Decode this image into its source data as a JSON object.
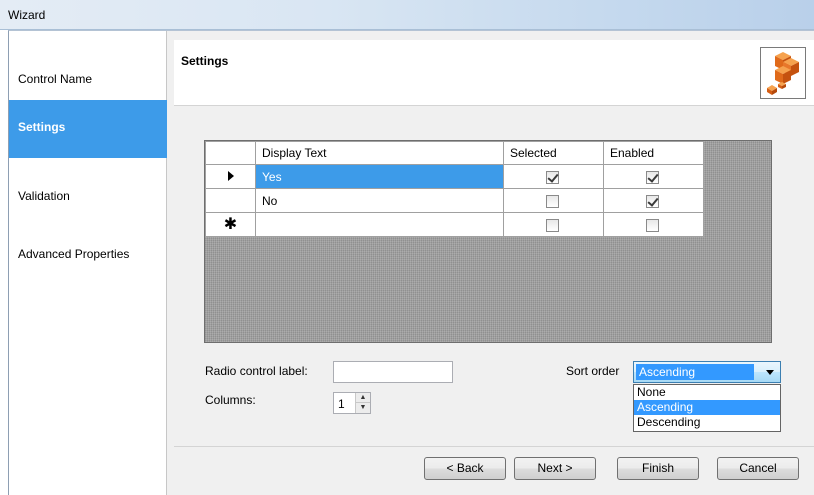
{
  "window": {
    "title": "Wizard"
  },
  "sidebar": {
    "items": [
      {
        "label": "Control Name"
      },
      {
        "label": "Settings"
      },
      {
        "label": "Validation"
      },
      {
        "label": "Advanced Properties"
      }
    ]
  },
  "header": {
    "title": "Settings",
    "logo_icon": "cubes-icon"
  },
  "grid": {
    "columns": [
      "Display Text",
      "Selected",
      "Enabled"
    ],
    "rows": [
      {
        "text": "Yes",
        "selected": true,
        "enabled": true,
        "current": true
      },
      {
        "text": "No",
        "selected": false,
        "enabled": true,
        "current": false
      },
      {
        "text": "",
        "selected": false,
        "enabled": false,
        "new_row": true
      }
    ]
  },
  "form": {
    "radio_label": {
      "label": "Radio control label:",
      "value": ""
    },
    "columns": {
      "label": "Columns:",
      "value": "1"
    },
    "sort_order": {
      "label": "Sort order",
      "value": "Ascending",
      "options": [
        "None",
        "Ascending",
        "Descending"
      ]
    }
  },
  "buttons": {
    "back": "< Back",
    "next": "Next >",
    "finish": "Finish",
    "cancel": "Cancel"
  }
}
